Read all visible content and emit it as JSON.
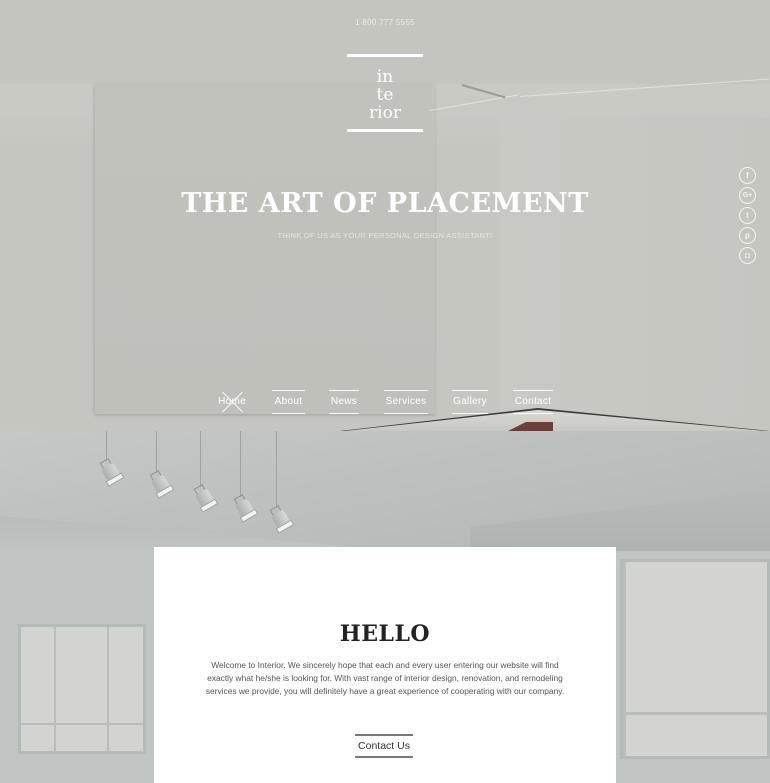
{
  "header": {
    "phone": "1 800 777 5555",
    "logo_lines": [
      "in",
      "te",
      "rior"
    ]
  },
  "hero": {
    "title": "THE ART OF PLACEMENT",
    "subtitle": "THINK OF US AS YOUR PERSONAL DESIGN ASSISTANT!"
  },
  "social": [
    {
      "name": "facebook-icon",
      "glyph": "f"
    },
    {
      "name": "google-plus-icon",
      "glyph": "G+"
    },
    {
      "name": "twitter-icon",
      "glyph": "t"
    },
    {
      "name": "pinterest-icon",
      "glyph": "p"
    },
    {
      "name": "instagram-icon",
      "glyph": "◘"
    }
  ],
  "nav": {
    "items": [
      {
        "label": "Home",
        "active": true
      },
      {
        "label": "About",
        "active": false
      },
      {
        "label": "News",
        "active": false
      },
      {
        "label": "Services",
        "active": false
      },
      {
        "label": "Gallery",
        "active": false
      },
      {
        "label": "Contact",
        "active": false
      }
    ]
  },
  "hello": {
    "title": "HELLO",
    "body": "Welcome to Interior. We sincerely hope that each and every user entering our website will find exactly what he/she is looking for. With vast range of interior design, renovation, and remodeling services we provide, you will definitely have a great experience of cooperating with our company.",
    "cta_label": "Contact Us"
  },
  "colors": {
    "hero_bg": "#c6c6c1",
    "text_on_hero": "#ffffff",
    "card_bg": "#ffffff",
    "card_title": "#222222",
    "card_text": "#555555"
  }
}
